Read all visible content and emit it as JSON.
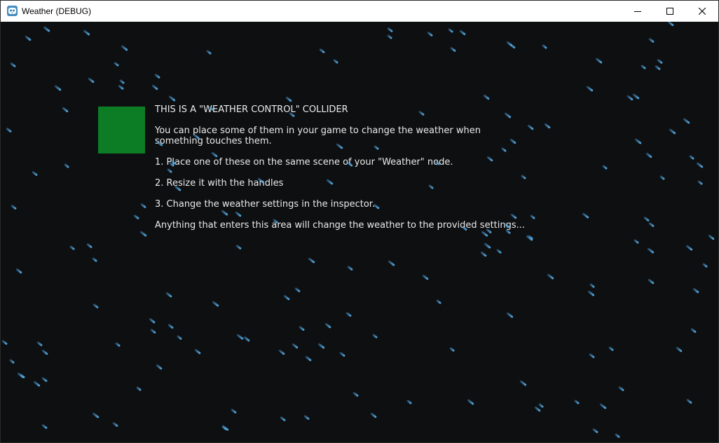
{
  "window": {
    "title": "Weather (DEBUG)",
    "app_icon": "godot-engine-icon",
    "controls": {
      "minimize_icon": "minimize-icon",
      "maximize_icon": "maximize-icon",
      "close_icon": "close-icon"
    }
  },
  "scene": {
    "background_color": "#0e0f11",
    "weather": "rain",
    "rain_color": "#56aee6",
    "collider_color": "#0c7d25"
  },
  "info": {
    "heading": "THIS IS A \"WEATHER CONTROL\" COLLIDER",
    "line1a": "You can place some of them in your game to change the weather when",
    "line1b": "something touches them.",
    "step1": "1. Place one of these on the same scene of your \"Weather\" node.",
    "step2": "2. Resize it with the handles",
    "step3": "3. Change the weather settings in the inspector.",
    "footer": "Anything that enters this area will change the weather to the provided settings..."
  }
}
